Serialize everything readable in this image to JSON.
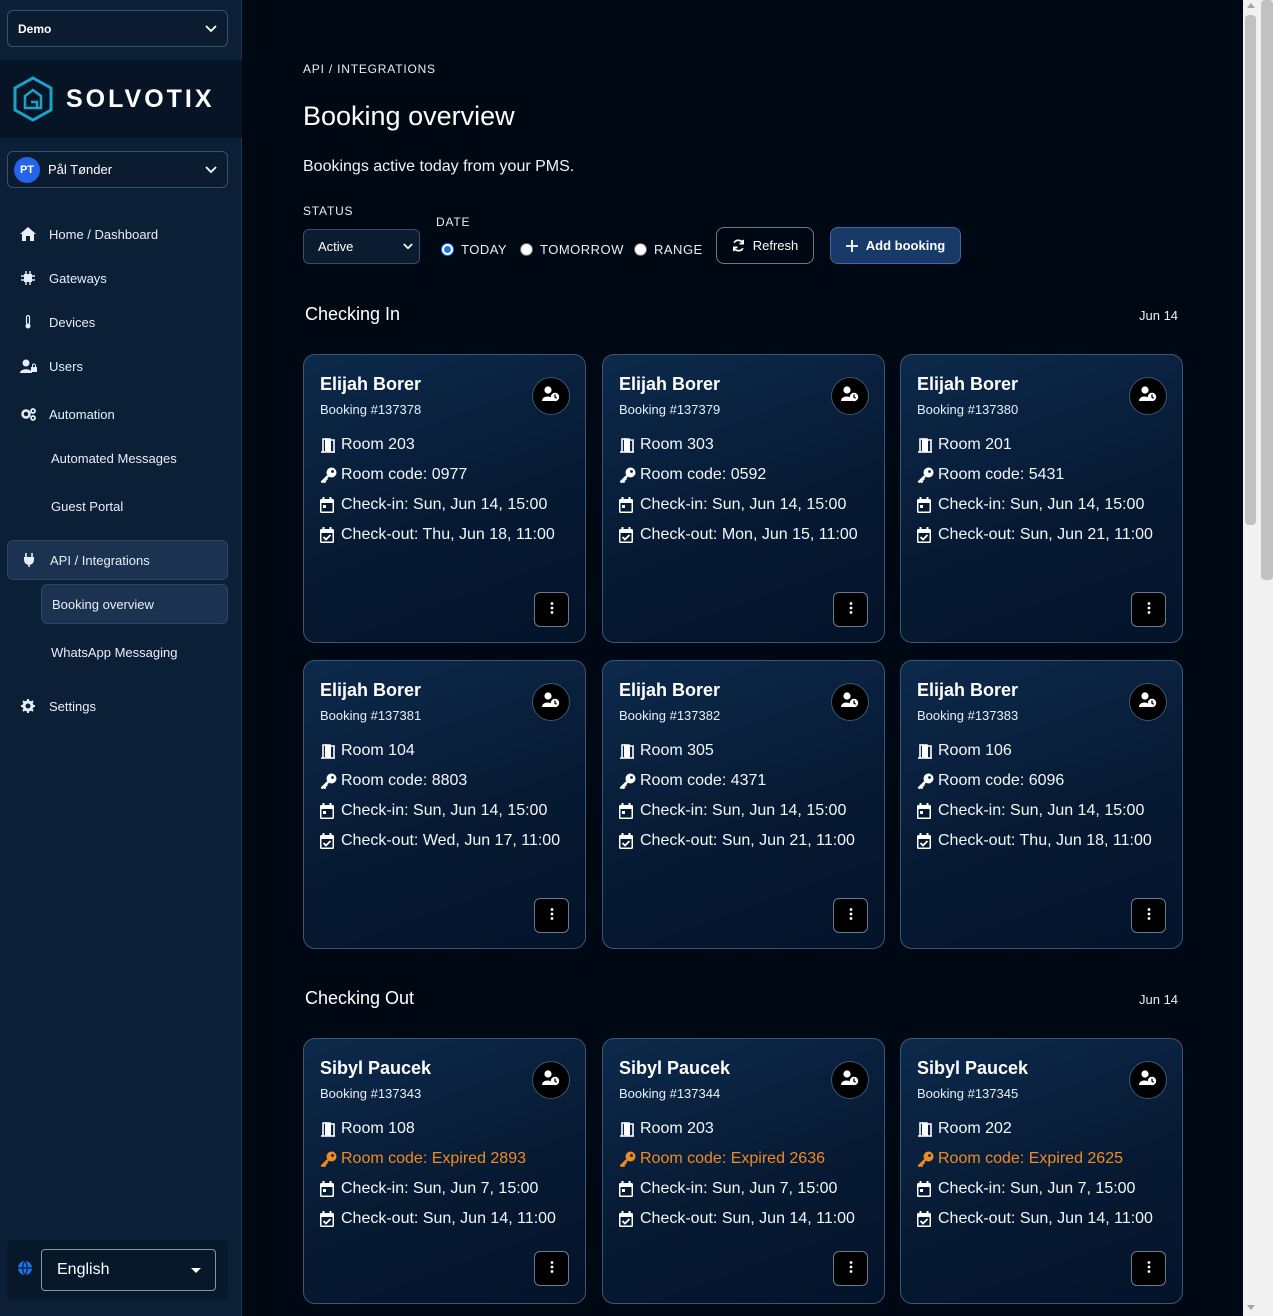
{
  "org": {
    "selected": "Demo"
  },
  "brand": {
    "name": "SOLVOTIX"
  },
  "user": {
    "initials": "PT",
    "name": "Pål Tønder"
  },
  "nav": {
    "home": "Home / Dashboard",
    "gateways": "Gateways",
    "devices": "Devices",
    "users": "Users",
    "automation": "Automation",
    "automated_messages": "Automated Messages",
    "guest_portal": "Guest Portal",
    "api": "API / Integrations",
    "booking_overview": "Booking overview",
    "whatsapp": "WhatsApp Messaging",
    "settings": "Settings"
  },
  "language": {
    "selected": "English"
  },
  "page": {
    "breadcrumb": "API / INTEGRATIONS",
    "title": "Booking overview",
    "subtitle": "Bookings active today from your PMS."
  },
  "filters": {
    "status_label": "STATUS",
    "status_value": "Active",
    "date_label": "DATE",
    "today": "TODAY",
    "tomorrow": "TOMORROW",
    "range": "RANGE",
    "selected_date": "today",
    "refresh": "Refresh",
    "add": "Add booking"
  },
  "checking_in": {
    "title": "Checking In",
    "date": "Jun 14",
    "bookings": [
      {
        "guest": "Elijah Borer",
        "booking": "Booking #137378",
        "room": "Room 203",
        "code": "Room code: 0977",
        "checkin": "Check-in: Sun, Jun 14, 15:00",
        "checkout": "Check-out: Thu, Jun 18, 11:00"
      },
      {
        "guest": "Elijah Borer",
        "booking": "Booking #137379",
        "room": "Room 303",
        "code": "Room code: 0592",
        "checkin": "Check-in: Sun, Jun 14, 15:00",
        "checkout": "Check-out: Mon, Jun 15, 11:00"
      },
      {
        "guest": "Elijah Borer",
        "booking": "Booking #137380",
        "room": "Room 201",
        "code": "Room code: 5431",
        "checkin": "Check-in: Sun, Jun 14, 15:00",
        "checkout": "Check-out: Sun, Jun 21, 11:00"
      },
      {
        "guest": "Elijah Borer",
        "booking": "Booking #137381",
        "room": "Room 104",
        "code": "Room code: 8803",
        "checkin": "Check-in: Sun, Jun 14, 15:00",
        "checkout": "Check-out: Wed, Jun 17, 11:00"
      },
      {
        "guest": "Elijah Borer",
        "booking": "Booking #137382",
        "room": "Room 305",
        "code": "Room code: 4371",
        "checkin": "Check-in: Sun, Jun 14, 15:00",
        "checkout": "Check-out: Sun, Jun 21, 11:00"
      },
      {
        "guest": "Elijah Borer",
        "booking": "Booking #137383",
        "room": "Room 106",
        "code": "Room code: 6096",
        "checkin": "Check-in: Sun, Jun 14, 15:00",
        "checkout": "Check-out: Thu, Jun 18, 11:00"
      }
    ]
  },
  "checking_out": {
    "title": "Checking Out",
    "date": "Jun 14",
    "bookings": [
      {
        "guest": "Sibyl Paucek",
        "booking": "Booking #137343",
        "room": "Room 108",
        "code": "Room code: Expired 2893",
        "checkin": "Check-in: Sun, Jun 7, 15:00",
        "checkout": "Check-out: Sun, Jun 14, 11:00"
      },
      {
        "guest": "Sibyl Paucek",
        "booking": "Booking #137344",
        "room": "Room 203",
        "code": "Room code: Expired 2636",
        "checkin": "Check-in: Sun, Jun 7, 15:00",
        "checkout": "Check-out: Sun, Jun 14, 11:00"
      },
      {
        "guest": "Sibyl Paucek",
        "booking": "Booking #137345",
        "room": "Room 202",
        "code": "Room code: Expired 2625",
        "checkin": "Check-in: Sun, Jun 7, 15:00",
        "checkout": "Check-out: Sun, Jun 14, 11:00"
      }
    ]
  },
  "colors": {
    "expired": "#f08a24",
    "accent": "#1a73e8",
    "background": "#000814"
  }
}
